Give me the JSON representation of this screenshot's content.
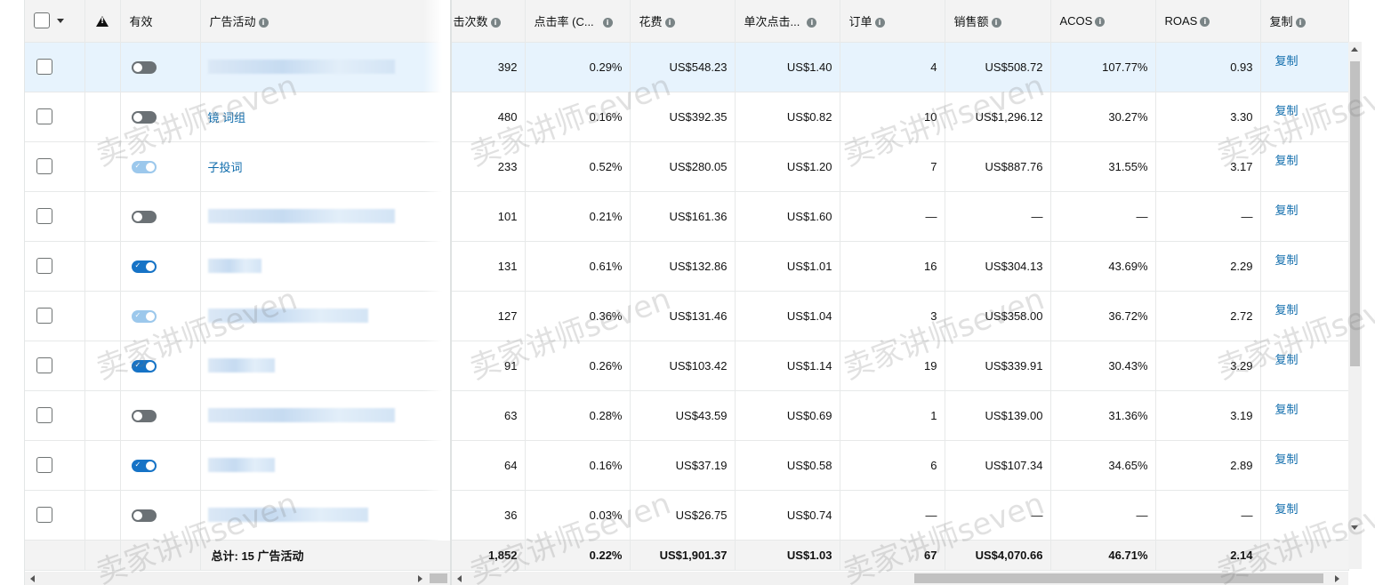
{
  "header": {
    "enabled": "有效",
    "campaign": "广告活动",
    "clicks": "击次数",
    "ctr": "点击率 (C...",
    "spend": "花费",
    "cpc": "单次点击...",
    "orders": "订单",
    "sales": "销售额",
    "acos": "ACOS",
    "roas": "ROAS",
    "copy": "复制"
  },
  "rows": [
    {
      "toggle": "off",
      "name": "",
      "blur": 210,
      "clicks": "392",
      "ctr": "0.29%",
      "spend": "US$548.23",
      "cpc": "US$1.40",
      "orders": "4",
      "sales": "US$508.72",
      "acos": "107.77%",
      "roas": "0.93",
      "copy": "复制",
      "highlight": true
    },
    {
      "toggle": "off",
      "name": "镜 词组",
      "blur": 0,
      "clicks": "480",
      "ctr": "0.16%",
      "spend": "US$392.35",
      "cpc": "US$0.82",
      "orders": "10",
      "sales": "US$1,296.12",
      "acos": "30.27%",
      "roas": "3.30",
      "copy": "复制"
    },
    {
      "toggle": "dim",
      "name": "子投词",
      "blur": 0,
      "clicks": "233",
      "ctr": "0.52%",
      "spend": "US$280.05",
      "cpc": "US$1.20",
      "orders": "7",
      "sales": "US$887.76",
      "acos": "31.55%",
      "roas": "3.17",
      "copy": "复制"
    },
    {
      "toggle": "off",
      "name": "",
      "blur": 210,
      "clicks": "101",
      "ctr": "0.21%",
      "spend": "US$161.36",
      "cpc": "US$1.60",
      "orders": "—",
      "sales": "—",
      "acos": "—",
      "roas": "—",
      "copy": "复制"
    },
    {
      "toggle": "on",
      "name": "",
      "blur": 60,
      "clicks": "131",
      "ctr": "0.61%",
      "spend": "US$132.86",
      "cpc": "US$1.01",
      "orders": "16",
      "sales": "US$304.13",
      "acos": "43.69%",
      "roas": "2.29",
      "copy": "复制"
    },
    {
      "toggle": "dim",
      "name": "",
      "blur": 180,
      "clicks": "127",
      "ctr": "0.36%",
      "spend": "US$131.46",
      "cpc": "US$1.04",
      "orders": "3",
      "sales": "US$358.00",
      "acos": "36.72%",
      "roas": "2.72",
      "copy": "复制"
    },
    {
      "toggle": "on",
      "name": "",
      "blur": 75,
      "clicks": "91",
      "ctr": "0.26%",
      "spend": "US$103.42",
      "cpc": "US$1.14",
      "orders": "19",
      "sales": "US$339.91",
      "acos": "30.43%",
      "roas": "3.29",
      "copy": "复制"
    },
    {
      "toggle": "off",
      "name": "",
      "blur": 210,
      "clicks": "63",
      "ctr": "0.28%",
      "spend": "US$43.59",
      "cpc": "US$0.69",
      "orders": "1",
      "sales": "US$139.00",
      "acos": "31.36%",
      "roas": "3.19",
      "copy": "复制"
    },
    {
      "toggle": "on",
      "name": "",
      "blur": 75,
      "clicks": "64",
      "ctr": "0.16%",
      "spend": "US$37.19",
      "cpc": "US$0.58",
      "orders": "6",
      "sales": "US$107.34",
      "acos": "34.65%",
      "roas": "2.89",
      "copy": "复制"
    },
    {
      "toggle": "off",
      "name": "",
      "blur": 180,
      "clicks": "36",
      "ctr": "0.03%",
      "spend": "US$26.75",
      "cpc": "US$0.74",
      "orders": "—",
      "sales": "—",
      "acos": "—",
      "roas": "—",
      "copy": "复制"
    }
  ],
  "totals": {
    "label": "总计:   15 广告活动",
    "clicks": "1,852",
    "ctr": "0.22%",
    "spend": "US$1,901.37",
    "cpc": "US$1.03",
    "orders": "67",
    "sales": "US$4,070.66",
    "acos": "46.71%",
    "roas": "2.14"
  },
  "watermark": "卖家讲师seven",
  "colors": {
    "link": "#0f6cac",
    "toggle_on": "#1673c6",
    "toggle_off": "#6b7175",
    "row_highlight": "#e7f3fd",
    "header_bg": "#f3f3f3"
  }
}
